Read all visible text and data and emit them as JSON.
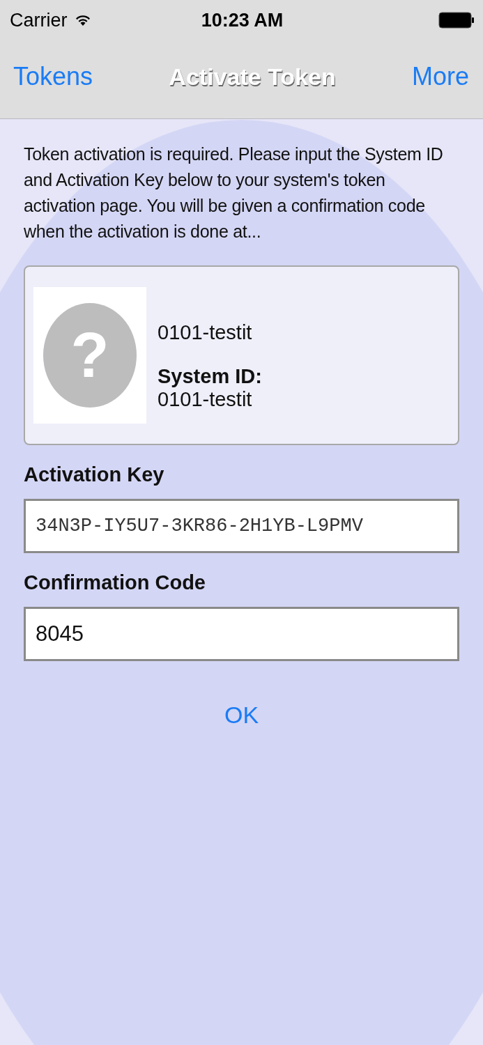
{
  "status_bar": {
    "carrier": "Carrier",
    "time": "10:23 AM"
  },
  "nav_bar": {
    "back": "Tokens",
    "title": "Activate Token",
    "action": "More"
  },
  "instructions": "Token activation is required. Please input the System ID and Activation Key below to your system's token activation page. You will be given a confirmation code when the activation is done at...",
  "token": {
    "icon_glyph": "?",
    "name": "0101-testit",
    "system_id_label": "System ID:",
    "system_id": "0101-testit"
  },
  "fields": [
    {
      "label": "Activation Key",
      "value": "34N3P-IY5U7-3KR86-2H1YB-L9PMV",
      "kind": "mono"
    },
    {
      "label": "Confirmation Code",
      "value": "8045",
      "kind": "plain"
    }
  ],
  "buttons": [
    "OK"
  ]
}
